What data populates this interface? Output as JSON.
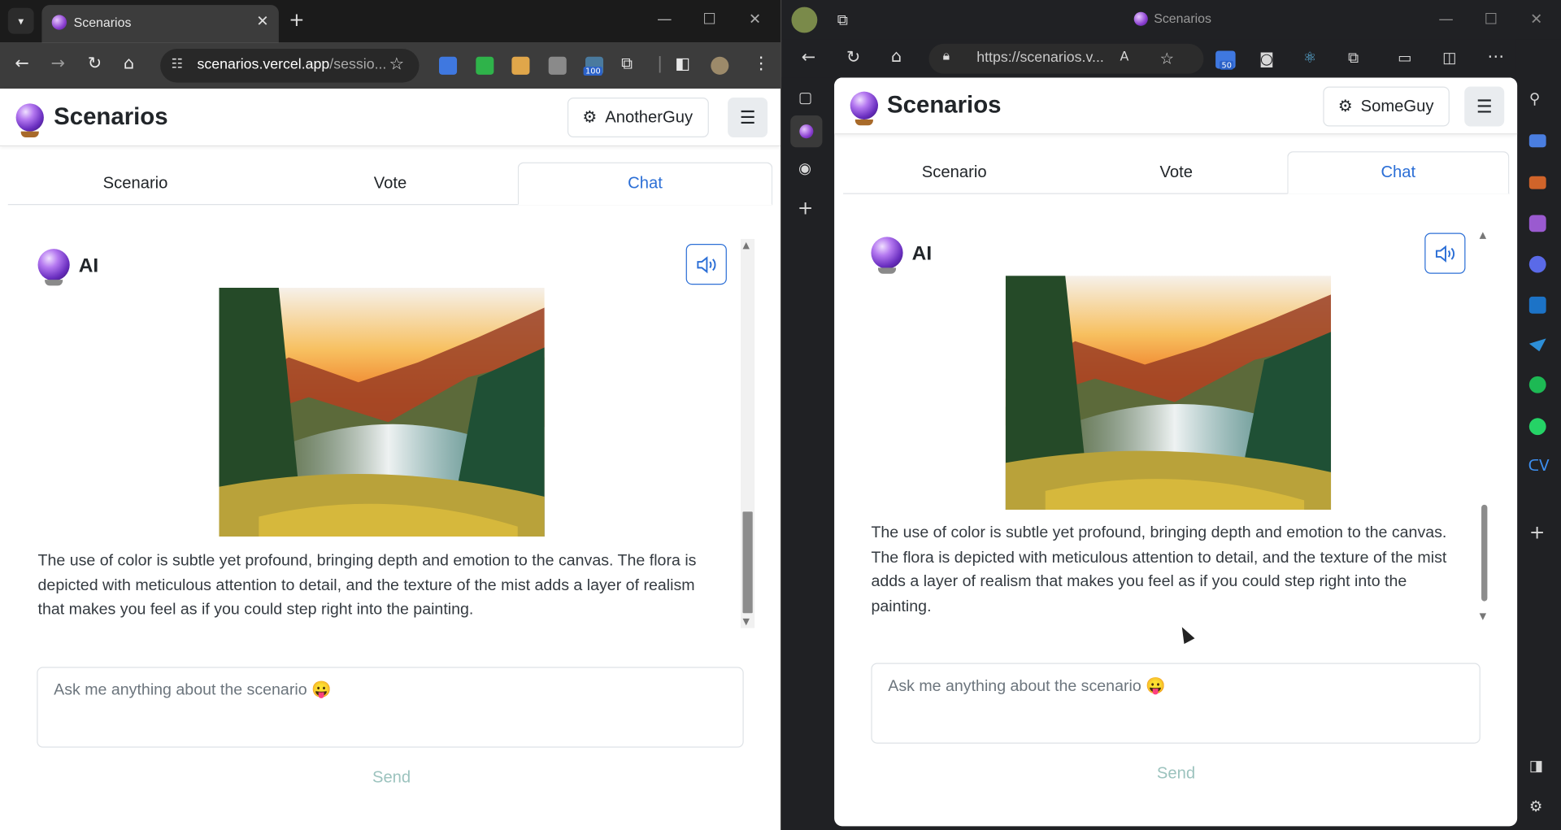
{
  "left_browser": {
    "tab_title": "Scenarios",
    "url_main": "scenarios.vercel.app",
    "url_rest": "/sessio...",
    "ext_badge": "100",
    "app_title": "Scenarios",
    "user_name": "AnotherGuy",
    "tabs": [
      "Scenario",
      "Vote",
      "Chat"
    ],
    "active_tab": "Chat",
    "message_author": "AI",
    "message_text": "The use of color is subtle yet profound, bringing depth and emotion to the canvas. The flora is depicted with meticulous attention to detail, and the texture of the mist adds a layer of realism that makes you feel as if you could step right into the painting.",
    "input_placeholder": "Ask me anything about the scenario 😛",
    "send_label": "Send"
  },
  "right_browser": {
    "window_title": "Scenarios",
    "url": "https://scenarios.v...",
    "ext_badge": "50",
    "app_title": "Scenarios",
    "user_name": "SomeGuy",
    "tabs": [
      "Scenario",
      "Vote",
      "Chat"
    ],
    "active_tab": "Chat",
    "message_author": "AI",
    "message_text": "The use of color is subtle yet profound, bringing depth and emotion to the canvas. The flora is depicted with meticulous attention to detail, and the texture of the mist adds a layer of realism that makes you feel as if you could step right into the painting.",
    "input_placeholder": "Ask me anything about the scenario 😛",
    "send_label": "Send"
  },
  "colors": {
    "accent": "#2c6fd6",
    "send_disabled": "#9cc3be",
    "chrome_dark": "#3c3c3c",
    "edge_dark": "#202124"
  },
  "icons": {
    "speaker": "speaker-volume-icon",
    "settings": "gear-icon",
    "menu": "hamburger-menu-icon",
    "logo": "crystal-ball-icon"
  }
}
